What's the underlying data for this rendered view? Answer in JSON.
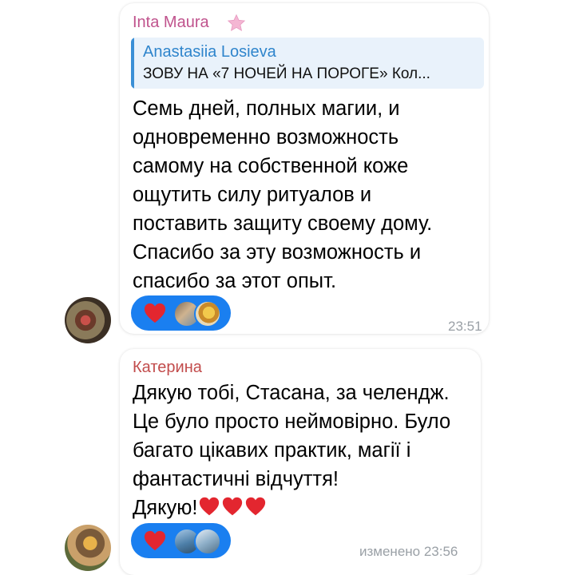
{
  "messages": [
    {
      "sender": "Inta Maura",
      "sender_color": "#c0538d",
      "badge_icon": "star-icon",
      "reply": {
        "author": "Anastasiia Losieva",
        "text": "ЗОВУ НА «7 НОЧЕЙ НА ПОРОГЕ» Кол..."
      },
      "lines": [
        "Семь дней, полных магии, и",
        "одновременно возможность",
        "самому на собственной коже",
        "ощутить силу ритуалов и",
        "поставить защиту своему дому.",
        "Спасибо за эту возможность и",
        "спасибо за этот опыт."
      ],
      "reaction_icon": "red-heart-icon",
      "time": "23:51"
    },
    {
      "sender": "Катерина",
      "sender_color": "#c24c4c",
      "lines": [
        "Дякую тобі, Стасана, за челендж.",
        "Це було просто неймовірно. Було",
        "багато цікавих практик, магії і",
        "фантастичні відчуття!",
        "Дякую!"
      ],
      "trailing_emoji": [
        "red-heart-icon",
        "red-heart-icon",
        "red-heart-icon"
      ],
      "reaction_icon": "red-heart-icon",
      "time": "изменено 23:56"
    }
  ],
  "colors": {
    "reaction_pill": "#1a7ff0",
    "reply_accent": "#3a8fd6",
    "heart": "#e3262f"
  }
}
